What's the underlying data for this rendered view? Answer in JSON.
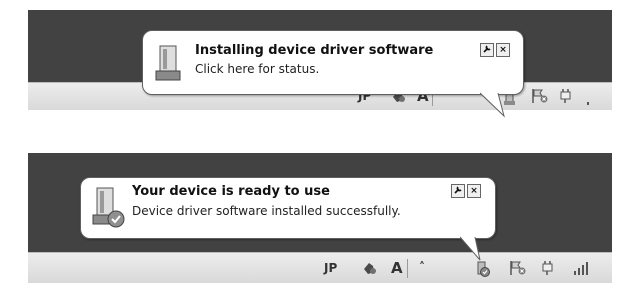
{
  "notifications": [
    {
      "title": "Installing device driver software",
      "message": "Click here for status.",
      "device_icon": "printer-device-icon",
      "options_icon": "wrench-icon",
      "close_label": "×"
    },
    {
      "title": "Your device is ready to use",
      "message": "Device driver software installed successfully.",
      "device_icon": "printer-device-check-icon",
      "options_icon": "wrench-icon",
      "close_label": "×"
    }
  ],
  "tray": {
    "language": "JP",
    "ime_mode": "A",
    "show_hidden_icons": "˄"
  }
}
